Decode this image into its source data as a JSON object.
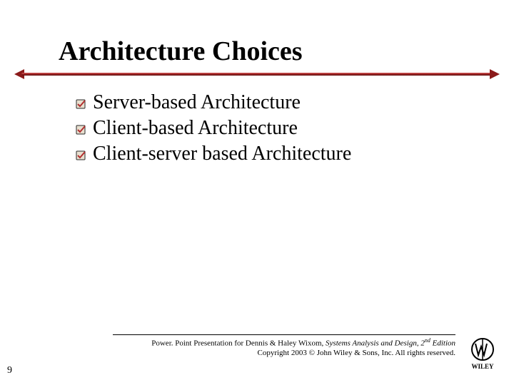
{
  "title": "Architecture Choices",
  "bullets": [
    "Server-based Architecture",
    "Client-based Architecture",
    "Client-server based Architecture"
  ],
  "footer": {
    "line1_prefix": "Power. Point Presentation for Dennis & Haley Wixom, ",
    "book_title": "Systems Analysis and Design, ",
    "edition_num": "2",
    "edition_suffix": "nd",
    "edition_word": " Edition",
    "line2": "Copyright 2003 © John Wiley & Sons, Inc.  All rights reserved."
  },
  "page_number": "9",
  "icons": {
    "bullet": "checkbox-icon",
    "publisher_logo": "wiley-logo"
  },
  "colors": {
    "divider": "#8b1a1a",
    "bullet_fill": "#e8e0d0",
    "bullet_stroke": "#2a2a2a",
    "bullet_check": "#b23030"
  }
}
